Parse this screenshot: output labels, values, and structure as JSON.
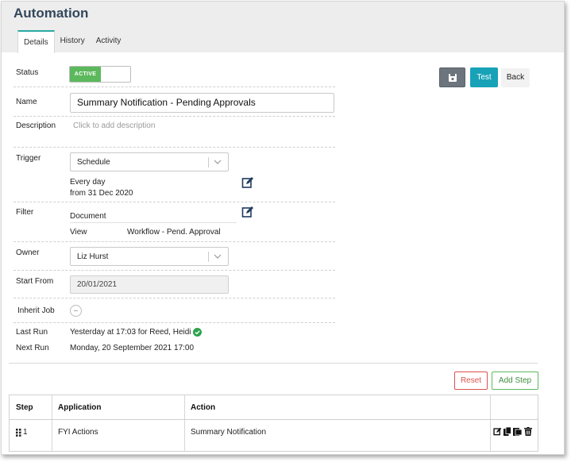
{
  "window": {
    "title": "Automation"
  },
  "tabs": [
    {
      "label": "Details",
      "active": true
    },
    {
      "label": "History",
      "active": false
    },
    {
      "label": "Activity",
      "active": false
    }
  ],
  "form": {
    "status": {
      "label": "Status",
      "value": "ACTIVE"
    },
    "name": {
      "label": "Name",
      "value": "Summary Notification - Pending Approvals"
    },
    "description": {
      "label": "Description",
      "placeholder": "Click to add description"
    },
    "trigger": {
      "label": "Trigger",
      "value": "Schedule",
      "schedule_line1": "Every day",
      "schedule_line2": "from 31 Dec 2020"
    },
    "filter": {
      "label": "Filter",
      "type": "Document",
      "view_label": "View",
      "view_value": "Workflow - Pend. Approval"
    },
    "owner": {
      "label": "Owner",
      "value": "Liz Hurst"
    },
    "start_from": {
      "label": "Start From",
      "value": "20/01/2021"
    },
    "inherit_job": {
      "label": "Inherit Job"
    },
    "last_run": {
      "label": "Last Run",
      "value": "Yesterday at 17:03 for Reed, Heidi"
    },
    "next_run": {
      "label": "Next Run",
      "value": "Monday, 20 September 2021 17:00"
    }
  },
  "toolbar": {
    "test_label": "Test",
    "back_label": "Back",
    "save_icon": "save-icon"
  },
  "steps": {
    "reset_label": "Reset",
    "add_label": "Add Step",
    "columns": [
      "Step",
      "Application",
      "Action"
    ],
    "rows": [
      {
        "step": "1",
        "application": "FYI Actions",
        "action": "Summary Notification"
      }
    ]
  },
  "colors": {
    "accent": "#17a2b8",
    "active_toggle": "#5cb85c",
    "reset": "#d9534f",
    "add_step": "#5cb85c",
    "title": "#33475b"
  }
}
